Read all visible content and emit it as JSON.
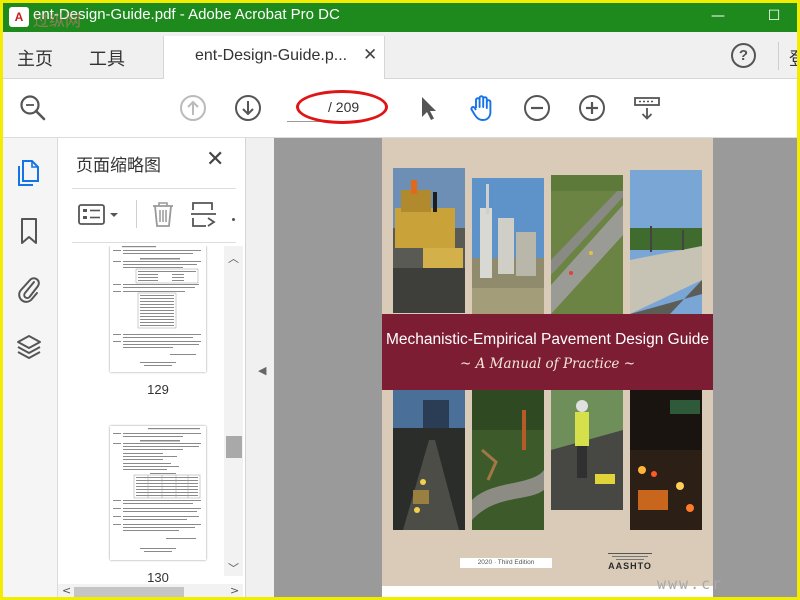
{
  "window": {
    "title": "ent-Design-Guide.pdf - Adobe Acrobat Pro DC",
    "watermark_top": "过纵网",
    "minimize": "—",
    "maximize": "☐"
  },
  "menu": {
    "home": "主页",
    "tools": "工具"
  },
  "tab": {
    "label": "ent-Design-Guide.p...",
    "close": "✕"
  },
  "header": {
    "help": "?",
    "search_partial": "登"
  },
  "toolbar": {
    "current_page": "",
    "page_total": "/ 209",
    "active_tool": "hand-tool"
  },
  "panel": {
    "title": "页面缩略图",
    "close": "✕",
    "thumbnails": [
      {
        "page": "129"
      },
      {
        "page": "130"
      }
    ]
  },
  "document": {
    "cover_title": "Mechanistic-Empirical Pavement Design Guide",
    "cover_subtitle": "~ A Manual of Practice ~",
    "edition": "2020 · Third Edition",
    "publisher": "AASHTO",
    "banner_color": "#7d1d33",
    "background_color": "#d9cbb8"
  },
  "colors": {
    "titlebar": "#1e8a1e",
    "accent": "#1473e6",
    "annotation": "#e01515",
    "frame": "#f2ec00"
  },
  "watermark_bottom": "www.cr"
}
